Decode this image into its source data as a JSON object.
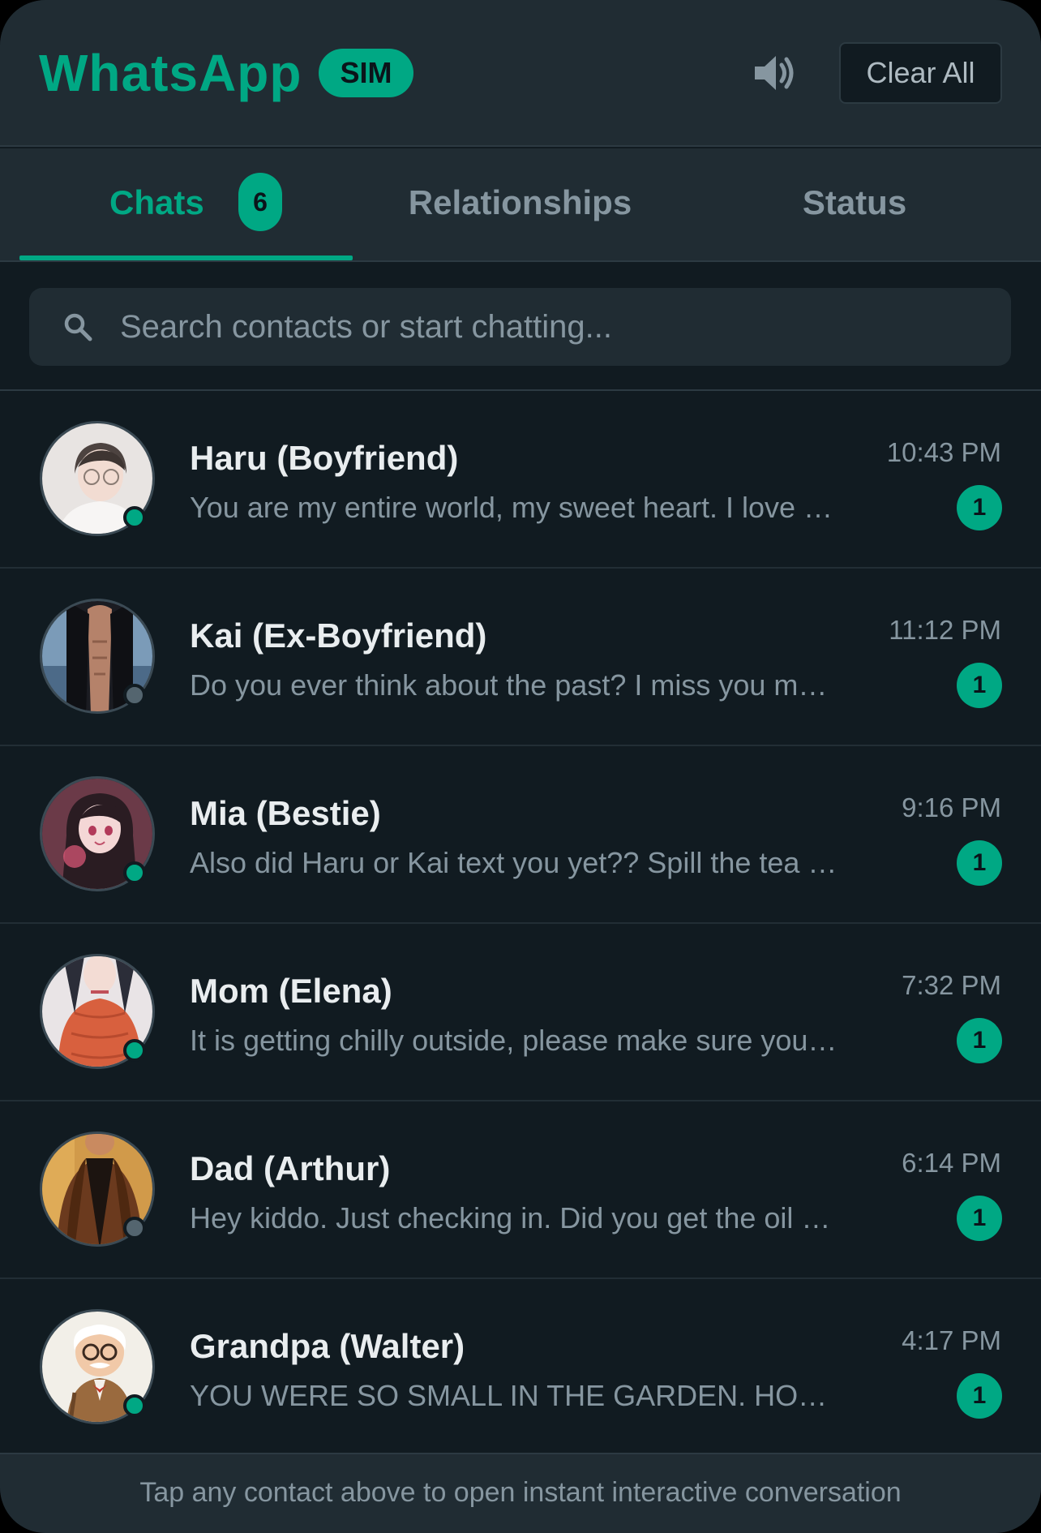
{
  "header": {
    "title": "WhatsApp",
    "badge": "SIM",
    "sound_icon": "speaker-volume-icon",
    "clear_label": "Clear All"
  },
  "tabs": [
    {
      "label": "Chats",
      "badge": "6",
      "active": true
    },
    {
      "label": "Relationships",
      "active": false
    },
    {
      "label": "Status",
      "active": false
    }
  ],
  "search": {
    "placeholder": "Search contacts or start chatting...",
    "icon": "search-icon"
  },
  "chats": [
    {
      "name": "Haru (Boyfriend)",
      "message": "You are my entire world, my sweet heart. I love you so much",
      "time": "10:43 PM",
      "unread": "1",
      "online": true
    },
    {
      "name": "Kai (Ex-Boyfriend)",
      "message": "Do you ever think about the past? I miss you more than I should",
      "time": "11:12 PM",
      "unread": "1",
      "online": false
    },
    {
      "name": "Mia (Bestie)",
      "message": "Also did Haru or Kai text you yet?? Spill the tea girl",
      "time": "9:16 PM",
      "unread": "1",
      "online": true
    },
    {
      "name": "Mom (Elena)",
      "message": "It is getting chilly outside, please make sure you wear a jacket",
      "time": "7:32 PM",
      "unread": "1",
      "online": true
    },
    {
      "name": "Dad (Arthur)",
      "message": "Hey kiddo. Just checking in. Did you get the oil changed?",
      "time": "6:14 PM",
      "unread": "1",
      "online": false
    },
    {
      "name": "Grandpa (Walter)",
      "message": "YOU WERE SO SMALL IN THE GARDEN. HOW TIME FLIES",
      "time": "4:17 PM",
      "unread": "1",
      "online": true
    }
  ],
  "footer": {
    "text": "Tap any contact above to open instant interactive conversation"
  },
  "colors": {
    "accent": "#00a884",
    "background": "#111b21",
    "panel": "#202c33"
  }
}
